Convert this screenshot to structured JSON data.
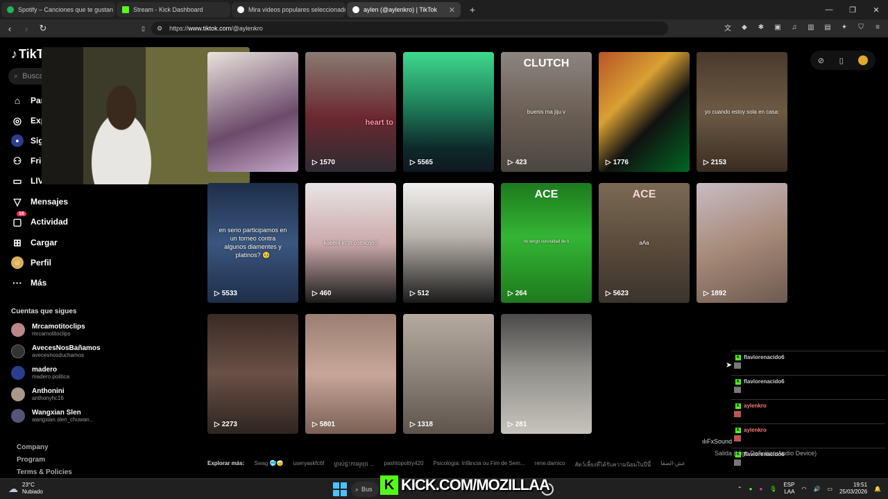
{
  "tabs": [
    {
      "label": "Spotify – Canciones que te gustan",
      "color": "#1db954"
    },
    {
      "label": "Stream - Kick Dashboard",
      "color": "#53fc18"
    },
    {
      "label": "Mira videos populares seleccionado",
      "color": "#ffffff"
    },
    {
      "label": "aylen (@aylenkro) | TikTok",
      "color": "#ffffff"
    }
  ],
  "address": {
    "prefix": "https://",
    "host": "www.tiktok.com",
    "path": "/@aylenkro"
  },
  "sidebar": {
    "logo": "TikTok",
    "search_placeholder": "Buscar",
    "nav": [
      {
        "label": "Para ti",
        "icon": "home-icon"
      },
      {
        "label": "Explorar",
        "icon": "compass-icon"
      },
      {
        "label": "Siguiendo",
        "icon": "following-icon"
      },
      {
        "label": "Friends",
        "icon": "friends-icon"
      },
      {
        "label": "LIVE",
        "icon": "live-icon"
      },
      {
        "label": "Mensajes",
        "icon": "messages-icon"
      },
      {
        "label": "Actividad",
        "icon": "activity-icon",
        "badge": "16"
      },
      {
        "label": "Cargar",
        "icon": "upload-icon"
      },
      {
        "label": "Perfil",
        "icon": "profile-icon"
      },
      {
        "label": "Más",
        "icon": "more-icon"
      }
    ],
    "following_title": "Cuentas que sigues",
    "following": [
      {
        "name": "Mrcamotitoclips",
        "handle": "mrcamotitoclips",
        "color": "#b88"
      },
      {
        "name": "AvecesNosBañamos",
        "handle": "avecesnosduchamos",
        "color": "#333"
      },
      {
        "name": "madero",
        "handle": "madero.politica",
        "color": "#2a3d8f"
      },
      {
        "name": "Anthonini",
        "handle": "anthonyhc16",
        "color": "#a98"
      },
      {
        "name": "Wangxian Slen",
        "handle": "wangxian.slen_chuwan...",
        "color": "#557"
      }
    ],
    "footer": [
      "Company",
      "Program",
      "Terms & Policies"
    ]
  },
  "videos": [
    {
      "views": "",
      "bg": "linear-gradient(160deg,#e9e3dc,#6b4a6a 60%,#c4a7c9)",
      "caption": "",
      "title": ""
    },
    {
      "views": "1570",
      "bg": "linear-gradient(180deg,#8a7b72,#6a2830 55%,#2e2b33)",
      "caption": "heart to",
      "title": ""
    },
    {
      "views": "5565",
      "bg": "linear-gradient(180deg,#3fd98d,#1e7e5a 45%,#0d2a2a 80%,#101820)",
      "caption": "",
      "title": ""
    },
    {
      "views": "423",
      "bg": "linear-gradient(180deg,#8b8580,#6d6055 50%,#4a4641)",
      "caption": "buenis ma jiju v",
      "title": "CLUTCH"
    },
    {
      "views": "1776",
      "bg": "linear-gradient(135deg,#b8542a,#d8a032 35%,#111 60%,#062)",
      "caption": "",
      "title": ""
    },
    {
      "views": "2153",
      "bg": "linear-gradient(180deg,#4a3a2c,#6c5a45 50%,#3a2c22)",
      "caption": "yo cuando estoy sola en casa:",
      "title": ""
    },
    {
      "views": "5533",
      "bg": "linear-gradient(180deg,#1e2e48,#3a5680 50%,#1e2e48)",
      "caption": "en serio participamos en un torneo contra algunos diamentes y platinos? 🥺",
      "title": ""
    },
    {
      "views": "460",
      "bg": "linear-gradient(180deg,#e9e4e6,#caa 50%,#1b1b1b)",
      "caption": "kabeni in th comicon!!",
      "title": ""
    },
    {
      "views": "512",
      "bg": "linear-gradient(180deg,#f1f0ee,#b9b3ad 45%,#1a1a1a)",
      "caption": "",
      "title": ""
    },
    {
      "views": "264",
      "bg": "linear-gradient(180deg,#1d7a1d,#34b534 45%,#1d7a1d)",
      "caption": "no tengo curiosidad de ti",
      "title": "ACE"
    },
    {
      "views": "5623",
      "bg": "linear-gradient(180deg,#7a6a55,#5c4c3c 50%,#3a342c)",
      "caption": "aAa",
      "title": "ACE"
    },
    {
      "views": "1892",
      "bg": "linear-gradient(160deg,#c7bcc4,#a78a7a 50%,#6d5a50)",
      "caption": "",
      "title": ""
    },
    {
      "views": "2273",
      "bg": "linear-gradient(180deg,#3a2a25,#6a5046 50%,#2d2420)",
      "caption": "",
      "title": ""
    },
    {
      "views": "5801",
      "bg": "linear-gradient(180deg,#9a7f72,#c8a79a 50%,#7a6055)",
      "caption": "",
      "title": ""
    },
    {
      "views": "1318",
      "bg": "linear-gradient(180deg,#b5aa9e,#8d827a 50%,#5e544c)",
      "caption": "",
      "title": ""
    },
    {
      "views": "281",
      "bg": "linear-gradient(180deg,#4c4a4a,#8f8e89 45%,#c7c4bd)",
      "caption": "",
      "title": ""
    }
  ],
  "explore": {
    "label": "Explorar más:",
    "items": [
      "Swag 🥶🤕",
      "useryaskfc6f",
      "ម្ចាស់ផ្ទះការអូមុដ ... ",
      "pashtopoltry420",
      "Psicologia: Infância ou Fim de Sem...",
      "rene.damico",
      "สัตว์เลี้ยงที่ได้รับความนิยมในปีนี้",
      "عش-الصفا"
    ]
  },
  "chat": [
    {
      "user": "flaviorenacido6",
      "color": "#cfcfcf"
    },
    {
      "user": "flaviorenacido6",
      "color": "#cfcfcf"
    },
    {
      "user": "aylenkro",
      "color": "#ff7a7a"
    },
    {
      "user": "aylenkro",
      "color": "#ff7a7a"
    },
    {
      "user": "flaviorenacido6",
      "color": "#cfcfcf"
    }
  ],
  "overlay": {
    "fxsound": "FxSound",
    "salida": "Salida (High Definition Audio Device)",
    "kick_text": "KICK.COM/MOZILLAA"
  },
  "taskbar": {
    "temp": "23°C",
    "weather": "Nubiado",
    "search": "Bus",
    "lang1": "ESP",
    "lang2": "LAA",
    "time": "19:51",
    "date": "25/03/2026"
  }
}
